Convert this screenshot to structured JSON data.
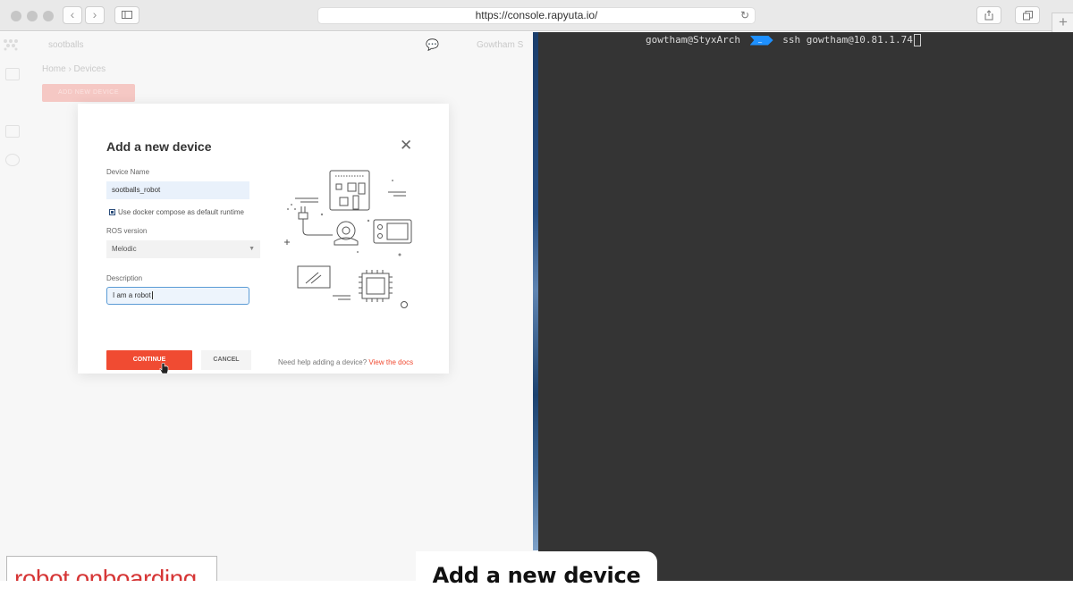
{
  "browser": {
    "url": "https://console.rapyuta.io/",
    "back_icon": "chevron-left-icon",
    "forward_icon": "chevron-right-icon",
    "sidebar_icon": "sidebar-icon",
    "reload_icon": "reload-icon",
    "share_icon": "share-icon",
    "tabs_icon": "tabs-icon",
    "new_tab_icon": "plus-icon"
  },
  "app": {
    "org": "sootballs",
    "breadcrumb": "Home  ›  Devices",
    "user": "Gowtham S",
    "add_button": "ADD NEW DEVICE"
  },
  "modal": {
    "title": "Add a new device",
    "close": "✕",
    "device_name_label": "Device Name",
    "device_name_value": "sootballs_robot",
    "docker_checkbox_label": "Use docker compose as default runtime",
    "docker_checked": true,
    "ros_label": "ROS version",
    "ros_value": "Melodic",
    "description_label": "Description",
    "description_value": "I am a robot",
    "continue": "CONTINUE",
    "cancel": "CANCEL",
    "help_text": "Need help adding a device?",
    "help_link": "View the docs"
  },
  "terminal": {
    "user_host": "gowtham@StyxArch",
    "path": "~",
    "command": "ssh gowtham@10.81.1.74"
  },
  "overlay": {
    "tag": "robot onboarding",
    "caption": "Add a new device"
  },
  "colors": {
    "accent": "#f04b32",
    "terminal_bg": "#343434",
    "prompt_arrow": "#1e90ff"
  }
}
